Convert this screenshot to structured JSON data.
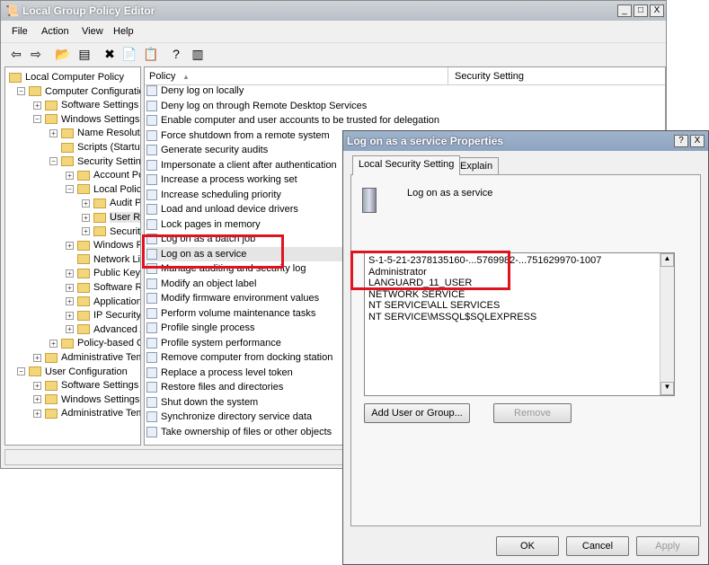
{
  "window": {
    "title": "Local Group Policy Editor",
    "controls": [
      "_",
      "□",
      "X"
    ]
  },
  "menu": [
    "File",
    "Action",
    "View",
    "Help"
  ],
  "toolbar": {
    "icons": [
      "back-icon",
      "forward-icon",
      "up-folder-icon",
      "show-hide-tree-icon",
      "delete-icon",
      "properties-icon",
      "export-icon",
      "help-icon",
      "action-pane-icon"
    ],
    "glyphs": [
      "⇦",
      "⇨",
      "📂",
      "▤",
      "✖",
      "📄",
      "📋",
      "?",
      "▥"
    ]
  },
  "tree": [
    {
      "label": "Local Computer Policy",
      "level": 0,
      "exp": ""
    },
    {
      "label": "Computer Configuration",
      "level": 1,
      "exp": "-"
    },
    {
      "label": "Software Settings",
      "level": 2,
      "exp": "+"
    },
    {
      "label": "Windows Settings",
      "level": 2,
      "exp": "-"
    },
    {
      "label": "Name Resolution Policy",
      "level": 3,
      "exp": "+"
    },
    {
      "label": "Scripts (Startup/Shutdown)",
      "level": 3,
      "exp": ""
    },
    {
      "label": "Security Settings",
      "level": 3,
      "exp": "-"
    },
    {
      "label": "Account Policies",
      "level": 4,
      "exp": "+"
    },
    {
      "label": "Local Policies",
      "level": 4,
      "exp": "-"
    },
    {
      "label": "Audit Policy",
      "level": 5,
      "exp": "+"
    },
    {
      "label": "User Rights Assignment",
      "level": 5,
      "exp": "+",
      "selected": true
    },
    {
      "label": "Security Options",
      "level": 5,
      "exp": "+"
    },
    {
      "label": "Windows Firewall with Advanced Security",
      "level": 4,
      "exp": "+"
    },
    {
      "label": "Network List Manager Policies",
      "level": 4,
      "exp": ""
    },
    {
      "label": "Public Key Policies",
      "level": 4,
      "exp": "+"
    },
    {
      "label": "Software Restriction Policies",
      "level": 4,
      "exp": "+"
    },
    {
      "label": "Application Control Policies",
      "level": 4,
      "exp": "+"
    },
    {
      "label": "IP Security Policies on Local Computer",
      "level": 4,
      "exp": "+"
    },
    {
      "label": "Advanced Audit Policy Configuration",
      "level": 4,
      "exp": "+"
    },
    {
      "label": "Policy-based QoS",
      "level": 3,
      "exp": "+"
    },
    {
      "label": "Administrative Templates",
      "level": 2,
      "exp": "+"
    },
    {
      "label": "User Configuration",
      "level": 1,
      "exp": "-"
    },
    {
      "label": "Software Settings",
      "level": 2,
      "exp": "+"
    },
    {
      "label": "Windows Settings",
      "level": 2,
      "exp": "+"
    },
    {
      "label": "Administrative Templates",
      "level": 2,
      "exp": "+"
    }
  ],
  "list": {
    "columns": [
      "Policy",
      "Security Setting"
    ],
    "rows": [
      "Deny log on locally",
      "Deny log on through Remote Desktop Services",
      "Enable computer and user accounts to be trusted for delegation",
      "Force shutdown from a remote system",
      "Generate security audits",
      "Impersonate a client after authentication",
      "Increase a process working set",
      "Increase scheduling priority",
      "Load and unload device drivers",
      "Lock pages in memory",
      "Log on as a batch job",
      "Log on as a service",
      "Manage auditing and security log",
      "Modify an object label",
      "Modify firmware environment values",
      "Perform volume maintenance tasks",
      "Profile single process",
      "Profile system performance",
      "Remove computer from docking station",
      "Replace a process level token",
      "Restore files and directories",
      "Shut down the system",
      "Synchronize directory service data",
      "Take ownership of files or other objects"
    ],
    "selected": "Log on as a service"
  },
  "dialog": {
    "title": "Log on as a service Properties",
    "controls": [
      "?",
      "X"
    ],
    "tabs": [
      "Local Security Setting",
      "Explain"
    ],
    "policy_name": "Log on as a service",
    "accounts": [
      "S-1-5-21-2378135160-...5769982-...751629970-1007",
      "Administrator",
      "LANGUARD_11_USER",
      "NETWORK SERVICE",
      "NT SERVICE\\ALL SERVICES",
      "NT SERVICE\\MSSQL$SQLEXPRESS"
    ],
    "add_button": "Add User or Group...",
    "remove_button": "Remove",
    "ok": "OK",
    "cancel": "Cancel",
    "apply": "Apply"
  },
  "colors": {
    "highlight": "#e0141e",
    "selection": "#e5e5e5"
  }
}
